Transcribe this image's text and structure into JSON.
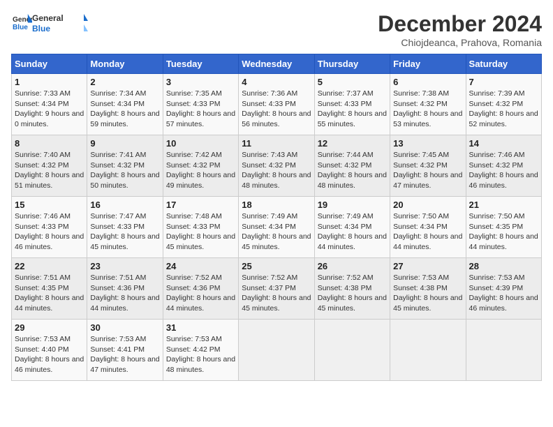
{
  "header": {
    "logo_general": "General",
    "logo_blue": "Blue",
    "main_title": "December 2024",
    "subtitle": "Chiojdeanca, Prahova, Romania"
  },
  "weekdays": [
    "Sunday",
    "Monday",
    "Tuesday",
    "Wednesday",
    "Thursday",
    "Friday",
    "Saturday"
  ],
  "weeks": [
    [
      {
        "day": "1",
        "info": "Sunrise: 7:33 AM\nSunset: 4:34 PM\nDaylight: 9 hours and 0 minutes."
      },
      {
        "day": "2",
        "info": "Sunrise: 7:34 AM\nSunset: 4:34 PM\nDaylight: 8 hours and 59 minutes."
      },
      {
        "day": "3",
        "info": "Sunrise: 7:35 AM\nSunset: 4:33 PM\nDaylight: 8 hours and 57 minutes."
      },
      {
        "day": "4",
        "info": "Sunrise: 7:36 AM\nSunset: 4:33 PM\nDaylight: 8 hours and 56 minutes."
      },
      {
        "day": "5",
        "info": "Sunrise: 7:37 AM\nSunset: 4:33 PM\nDaylight: 8 hours and 55 minutes."
      },
      {
        "day": "6",
        "info": "Sunrise: 7:38 AM\nSunset: 4:32 PM\nDaylight: 8 hours and 53 minutes."
      },
      {
        "day": "7",
        "info": "Sunrise: 7:39 AM\nSunset: 4:32 PM\nDaylight: 8 hours and 52 minutes."
      }
    ],
    [
      {
        "day": "8",
        "info": "Sunrise: 7:40 AM\nSunset: 4:32 PM\nDaylight: 8 hours and 51 minutes."
      },
      {
        "day": "9",
        "info": "Sunrise: 7:41 AM\nSunset: 4:32 PM\nDaylight: 8 hours and 50 minutes."
      },
      {
        "day": "10",
        "info": "Sunrise: 7:42 AM\nSunset: 4:32 PM\nDaylight: 8 hours and 49 minutes."
      },
      {
        "day": "11",
        "info": "Sunrise: 7:43 AM\nSunset: 4:32 PM\nDaylight: 8 hours and 48 minutes."
      },
      {
        "day": "12",
        "info": "Sunrise: 7:44 AM\nSunset: 4:32 PM\nDaylight: 8 hours and 48 minutes."
      },
      {
        "day": "13",
        "info": "Sunrise: 7:45 AM\nSunset: 4:32 PM\nDaylight: 8 hours and 47 minutes."
      },
      {
        "day": "14",
        "info": "Sunrise: 7:46 AM\nSunset: 4:32 PM\nDaylight: 8 hours and 46 minutes."
      }
    ],
    [
      {
        "day": "15",
        "info": "Sunrise: 7:46 AM\nSunset: 4:33 PM\nDaylight: 8 hours and 46 minutes."
      },
      {
        "day": "16",
        "info": "Sunrise: 7:47 AM\nSunset: 4:33 PM\nDaylight: 8 hours and 45 minutes."
      },
      {
        "day": "17",
        "info": "Sunrise: 7:48 AM\nSunset: 4:33 PM\nDaylight: 8 hours and 45 minutes."
      },
      {
        "day": "18",
        "info": "Sunrise: 7:49 AM\nSunset: 4:34 PM\nDaylight: 8 hours and 45 minutes."
      },
      {
        "day": "19",
        "info": "Sunrise: 7:49 AM\nSunset: 4:34 PM\nDaylight: 8 hours and 44 minutes."
      },
      {
        "day": "20",
        "info": "Sunrise: 7:50 AM\nSunset: 4:34 PM\nDaylight: 8 hours and 44 minutes."
      },
      {
        "day": "21",
        "info": "Sunrise: 7:50 AM\nSunset: 4:35 PM\nDaylight: 8 hours and 44 minutes."
      }
    ],
    [
      {
        "day": "22",
        "info": "Sunrise: 7:51 AM\nSunset: 4:35 PM\nDaylight: 8 hours and 44 minutes."
      },
      {
        "day": "23",
        "info": "Sunrise: 7:51 AM\nSunset: 4:36 PM\nDaylight: 8 hours and 44 minutes."
      },
      {
        "day": "24",
        "info": "Sunrise: 7:52 AM\nSunset: 4:36 PM\nDaylight: 8 hours and 44 minutes."
      },
      {
        "day": "25",
        "info": "Sunrise: 7:52 AM\nSunset: 4:37 PM\nDaylight: 8 hours and 45 minutes."
      },
      {
        "day": "26",
        "info": "Sunrise: 7:52 AM\nSunset: 4:38 PM\nDaylight: 8 hours and 45 minutes."
      },
      {
        "day": "27",
        "info": "Sunrise: 7:53 AM\nSunset: 4:38 PM\nDaylight: 8 hours and 45 minutes."
      },
      {
        "day": "28",
        "info": "Sunrise: 7:53 AM\nSunset: 4:39 PM\nDaylight: 8 hours and 46 minutes."
      }
    ],
    [
      {
        "day": "29",
        "info": "Sunrise: 7:53 AM\nSunset: 4:40 PM\nDaylight: 8 hours and 46 minutes."
      },
      {
        "day": "30",
        "info": "Sunrise: 7:53 AM\nSunset: 4:41 PM\nDaylight: 8 hours and 47 minutes."
      },
      {
        "day": "31",
        "info": "Sunrise: 7:53 AM\nSunset: 4:42 PM\nDaylight: 8 hours and 48 minutes."
      },
      null,
      null,
      null,
      null
    ]
  ]
}
